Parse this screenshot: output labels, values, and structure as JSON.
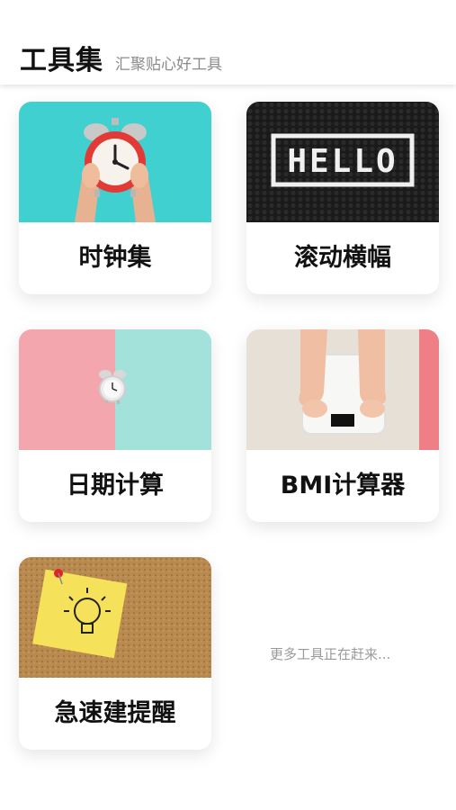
{
  "header": {
    "title": "工具集",
    "subtitle": "汇聚贴心好工具"
  },
  "tools": [
    {
      "label": "时钟集",
      "icon": "alarm-clock-photo"
    },
    {
      "label": "滚动横幅",
      "icon": "hello-tile-photo",
      "image_text": "HELLO"
    },
    {
      "label": "日期计算",
      "icon": "alarm-clock-pastel-photo"
    },
    {
      "label": "BMI计算器",
      "icon": "bathroom-scale-photo"
    },
    {
      "label": "急速建提醒",
      "icon": "lightbulb-sticky-note-photo"
    }
  ],
  "more_text": "更多工具正在赶来...",
  "colors": {
    "background": "#ffffff",
    "title": "#111111",
    "subtitle": "#8a8a8a",
    "more_text": "#9a9a9a"
  }
}
